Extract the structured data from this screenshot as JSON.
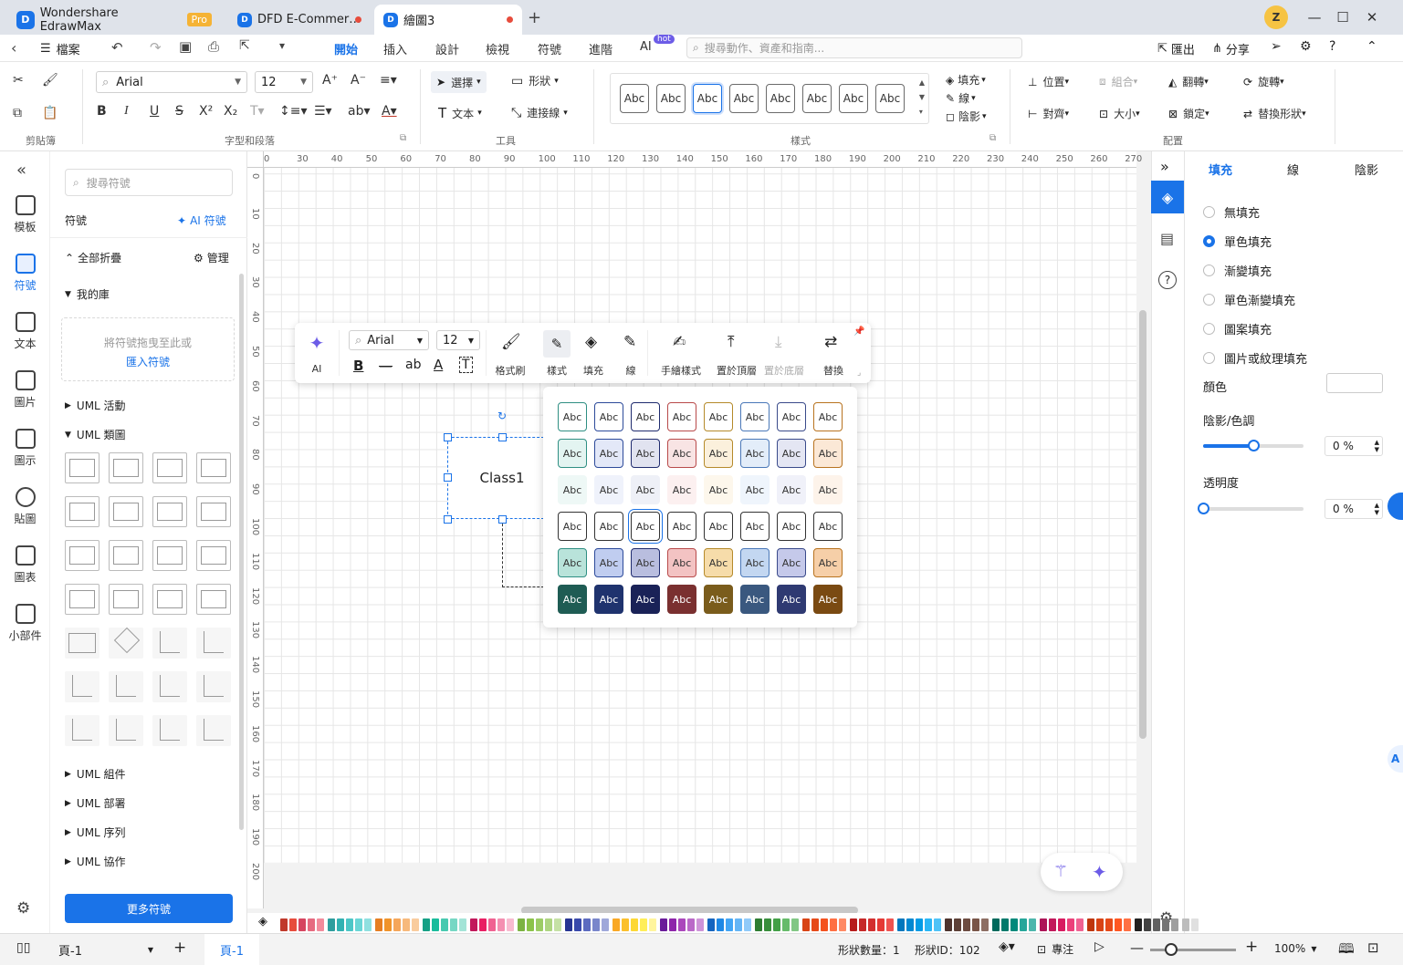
{
  "app": {
    "title": "Wondershare EdrawMax",
    "badge": "Pro"
  },
  "tabs": [
    {
      "label": "DFD E-Commer…"
    },
    {
      "label": "繪圖3"
    }
  ],
  "menu": {
    "file": "檔案",
    "items": [
      "開始",
      "插入",
      "設計",
      "檢視",
      "符號",
      "進階",
      "AI"
    ],
    "ai_badge": "hot",
    "search_placeholder": "搜尋動作、資產和指南...",
    "export": "匯出",
    "share": "分享"
  },
  "ribbon": {
    "font_family": "Arial",
    "font_size": "12",
    "select": "選擇",
    "shape": "形狀",
    "text": "文本",
    "connector": "連接線",
    "fill": "填充",
    "line": "線",
    "shadow": "陰影",
    "position": "位置",
    "group": "組合",
    "flip": "翻轉",
    "rotate": "旋轉",
    "align": "對齊",
    "size": "大小",
    "lock": "鎖定",
    "replace_shape": "替換形狀",
    "style_sample": "Abc",
    "groups": [
      "剪貼簿",
      "字型和段落",
      "工具",
      "樣式",
      "配置"
    ]
  },
  "rail": [
    "模板",
    "符號",
    "文本",
    "圖片",
    "圖示",
    "貼圖",
    "圖表",
    "小部件"
  ],
  "symbols": {
    "search_placeholder": "搜尋符號",
    "title": "符號",
    "ai_symbols": "AI 符號",
    "collapse_all": "全部折疊",
    "manage": "管理",
    "my_library": "我的庫",
    "drop_hint": "將符號拖曳至此或",
    "import": "匯入符號",
    "uml_activity": "UML 活動",
    "uml_class": "UML 類圖",
    "uml_component": "UML 組件",
    "uml_deployment": "UML 部署",
    "uml_sequence": "UML 序列",
    "uml_collab": "UML 協作",
    "more": "更多符號"
  },
  "ruler": {
    "top": [
      "0",
      "30",
      "40",
      "50",
      "60",
      "70",
      "80",
      "90",
      "100",
      "110",
      "120",
      "130",
      "140",
      "150",
      "160",
      "170",
      "180",
      "190",
      "200",
      "210",
      "220",
      "230",
      "240",
      "250",
      "260",
      "270"
    ],
    "left": [
      "0",
      "10",
      "20",
      "30",
      "40",
      "50",
      "60",
      "70",
      "80",
      "90",
      "100",
      "110",
      "120",
      "130",
      "140",
      "150",
      "160",
      "170",
      "180",
      "190",
      "200"
    ]
  },
  "shape": {
    "label": "Class1"
  },
  "floating_toolbar": {
    "ai": "AI",
    "font": "Arial",
    "size": "12",
    "format_painter": "格式刷",
    "style": "樣式",
    "fill": "填充",
    "line": "線",
    "sketch": "手繪樣式",
    "to_front": "置於頂層",
    "to_back": "置於底層",
    "replace": "替換"
  },
  "style_grid": {
    "sample": "Abc",
    "border_colors": [
      "#2f8f83",
      "#2c4a9a",
      "#1f2b6e",
      "#b84a4a",
      "#b58a2a",
      "#4a78b8",
      "#3a4a8a",
      "#b8731f"
    ],
    "light_fills": [
      "#e3f4f1",
      "#e3e8f8",
      "#e1e3f0",
      "#f8e4e4",
      "#fbf0dc",
      "#e3edf9",
      "#e4e6f3",
      "#fbe8d6"
    ],
    "pale_fills": [
      "#eef8f6",
      "#eff2fb",
      "#eef0f7",
      "#fcf0f0",
      "#fdf7ec",
      "#eff5fc",
      "#f0f1f9",
      "#fdf3ea"
    ],
    "mid_fills": [
      "#b9e3da",
      "#c0cdf0",
      "#b9bedf",
      "#f3c3c3",
      "#f6dcaa",
      "#c3d7f1",
      "#c5c9ea",
      "#f6cfa8"
    ],
    "dark_fills": [
      "#1f5c54",
      "#1f336e",
      "#1a2257",
      "#7a3030",
      "#7a5c1c",
      "#3a587f",
      "#2f3a72",
      "#7a4a12"
    ]
  },
  "right_panel": {
    "tabs": [
      "填充",
      "線",
      "陰影"
    ],
    "options": [
      "無填充",
      "單色填充",
      "漸變填充",
      "單色漸變填充",
      "圖案填充",
      "圖片或紋理填充"
    ],
    "selected_option": "單色填充",
    "color_label": "顏色",
    "shade_label": "陰影/色調",
    "shade_value": "0 %",
    "shade_level": 0.5,
    "transparency_label": "透明度",
    "transparency_value": "0 %",
    "transparency_level": 0
  },
  "palette": [
    "#c0392b",
    "#e74c3c",
    "#d64560",
    "#e66a80",
    "#f28b9c",
    "#2e9e9e",
    "#32b2b2",
    "#4cc6c6",
    "#6ad6d6",
    "#8fe0e0",
    "#e67e22",
    "#f0932b",
    "#f5a65b",
    "#f7b97c",
    "#f9cc9e",
    "#16a085",
    "#1abc9c",
    "#48c9b0",
    "#76d7c4",
    "#a3e4d7",
    "#c2185b",
    "#e91e63",
    "#f06292",
    "#f48fb1",
    "#f8bbd0",
    "#7cb342",
    "#8bc34a",
    "#9ccc65",
    "#aed581",
    "#c5e1a5",
    "#283593",
    "#3949ab",
    "#5c6bc0",
    "#7986cb",
    "#9fa8da",
    "#f9a825",
    "#fbc02d",
    "#fdd835",
    "#ffee58",
    "#fff59d",
    "#6a1b9a",
    "#8e24aa",
    "#ab47bc",
    "#ba68c8",
    "#ce93d8",
    "#1565c0",
    "#1e88e5",
    "#42a5f5",
    "#64b5f6",
    "#90caf9",
    "#2e7d32",
    "#388e3c",
    "#43a047",
    "#66bb6a",
    "#81c784",
    "#d84315",
    "#e64a19",
    "#f4511e",
    "#ff7043",
    "#ff8a65",
    "#b71c1c",
    "#c62828",
    "#d32f2f",
    "#e53935",
    "#ef5350",
    "#0277bd",
    "#0288d1",
    "#039be5",
    "#29b6f6",
    "#4fc3f7",
    "#4e342e",
    "#5d4037",
    "#6d4c41",
    "#795548",
    "#8d6e63",
    "#00695c",
    "#00796b",
    "#00897b",
    "#26a69a",
    "#4db6ac",
    "#ad1457",
    "#c2185b",
    "#d81b60",
    "#ec407a",
    "#f06292",
    "#bf360c",
    "#d84315",
    "#e64a19",
    "#ff5722",
    "#ff7043",
    "#212121",
    "#424242",
    "#616161",
    "#757575",
    "#9e9e9e",
    "#bdbdbd",
    "#e0e0e0"
  ],
  "status": {
    "page_select": "頁-1",
    "page_tab": "頁-1",
    "shape_count": "形狀數量：1",
    "shape_id": "形狀ID：102",
    "focus": "專注",
    "zoom": "100%"
  }
}
